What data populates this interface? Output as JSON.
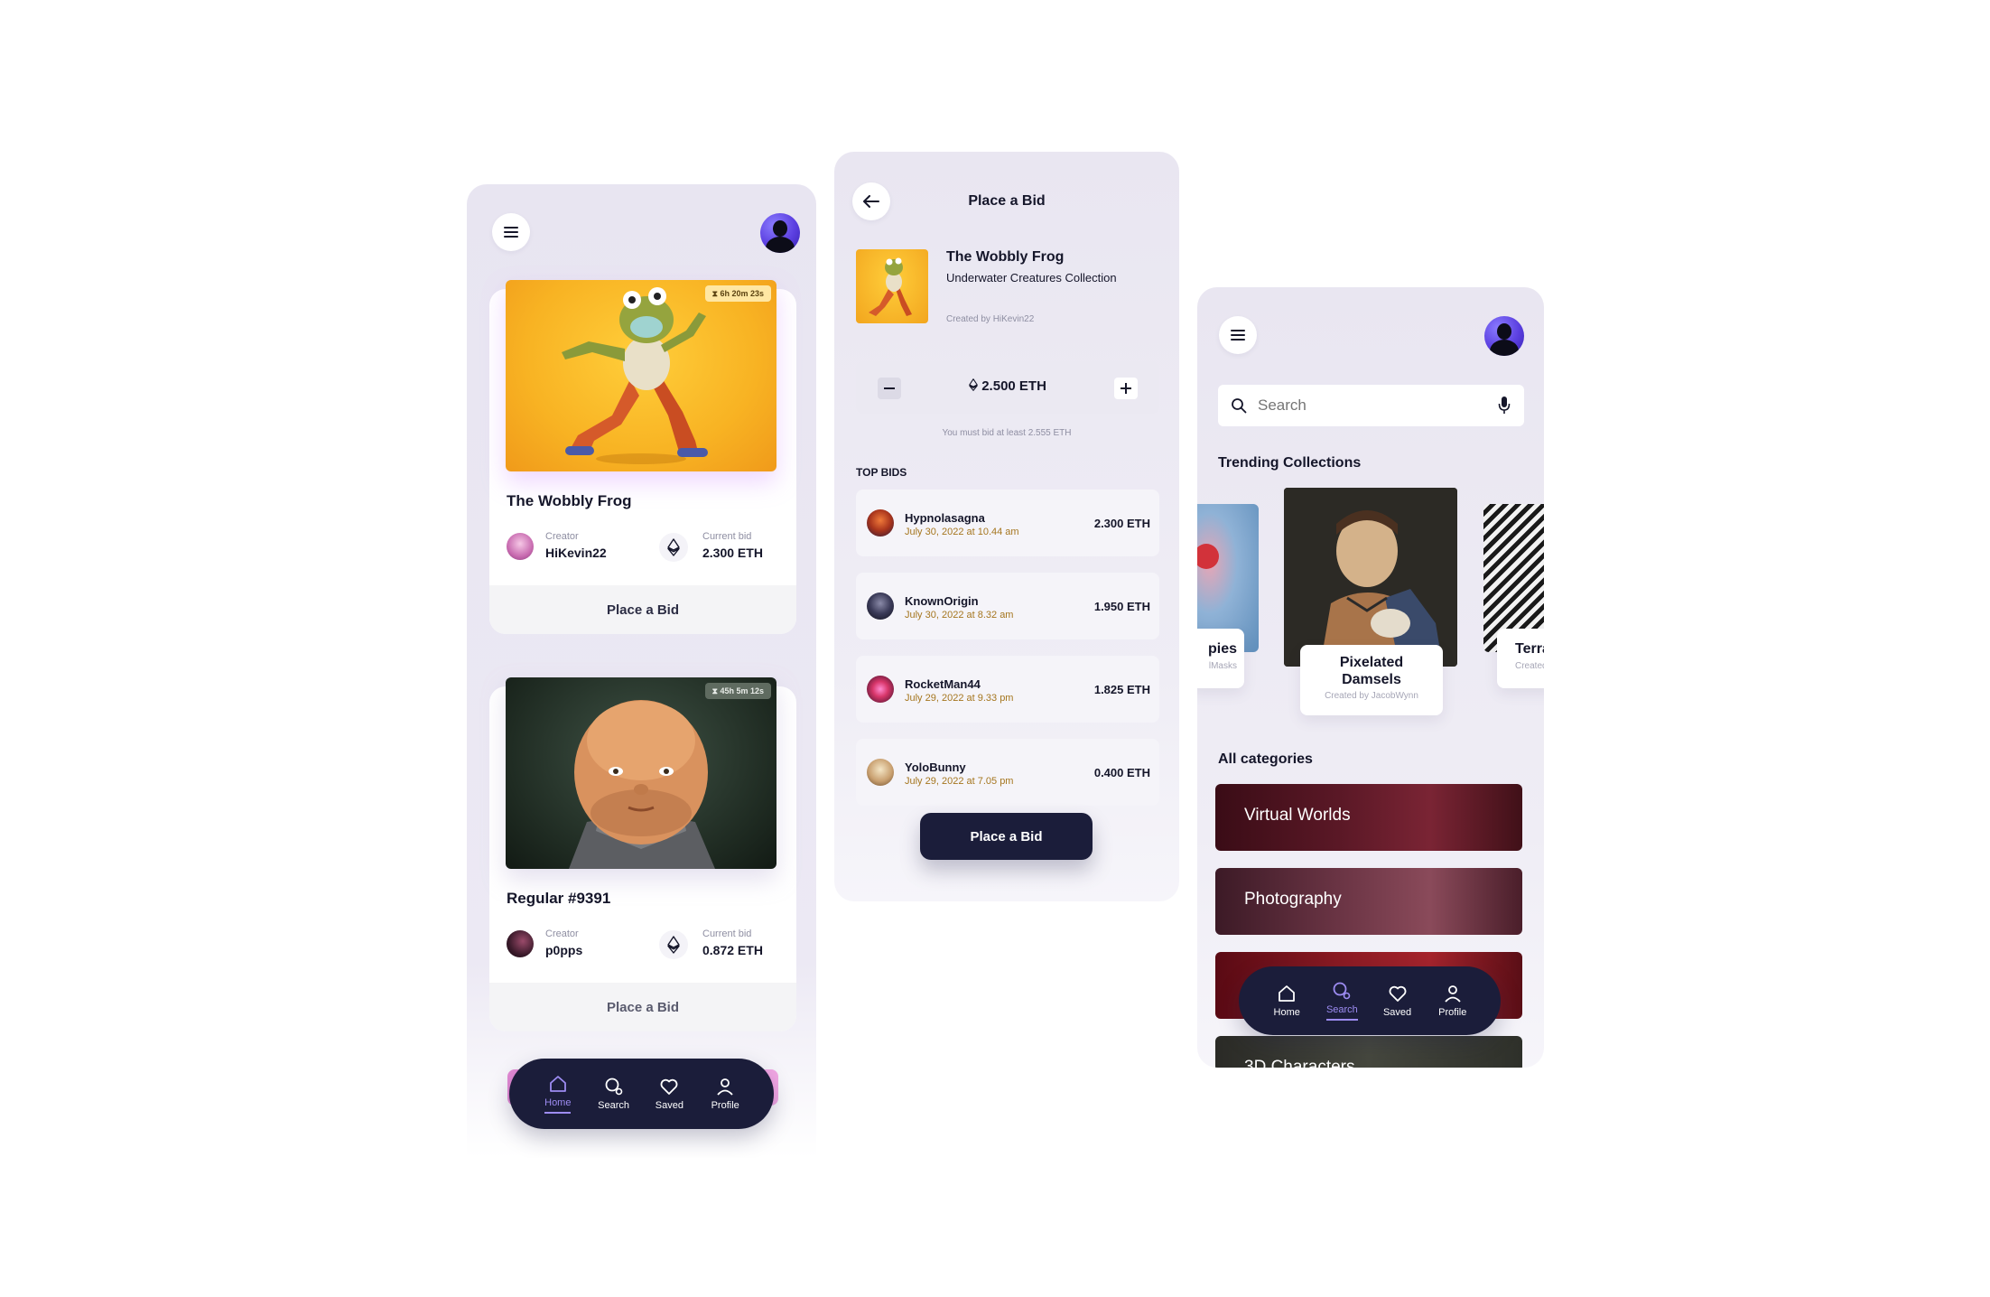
{
  "home": {
    "cards": [
      {
        "timer": "6h 20m 23s",
        "title": "The Wobbly Frog",
        "creator_label": "Creator",
        "creator": "HiKevin22",
        "bid_label": "Current bid",
        "bid": "2.300 ETH",
        "cta": "Place a Bid"
      },
      {
        "timer": "45h 5m 12s",
        "title": "Regular #9391",
        "creator_label": "Creator",
        "creator": "p0pps",
        "bid_label": "Current bid",
        "bid": "0.872 ETH",
        "cta": "Place a Bid"
      }
    ],
    "nav": {
      "home": "Home",
      "search": "Search",
      "saved": "Saved",
      "profile": "Profile",
      "active": "home"
    }
  },
  "bid_screen": {
    "title": "Place a Bid",
    "item_title": "The Wobbly Frog",
    "collection": "Underwater Creatures Collection",
    "created_by": "Created by HiKevin22",
    "amount": "2.500 ETH",
    "hint": "You must bid at least 2.555 ETH",
    "top_bids_label": "TOP BIDS",
    "bids": [
      {
        "name": "Hypnolasagna",
        "date": "July 30, 2022 at 10.44 am",
        "amount": "2.300 ETH"
      },
      {
        "name": "KnownOrigin",
        "date": "July 30, 2022 at 8.32 am",
        "amount": "1.950 ETH"
      },
      {
        "name": "RocketMan44",
        "date": "July 29, 2022 at 9.33 pm",
        "amount": "1.825 ETH"
      },
      {
        "name": "YoloBunny",
        "date": "July 29, 2022 at 7.05 pm",
        "amount": "0.400 ETH"
      }
    ],
    "cta": "Place a Bid"
  },
  "search_screen": {
    "search_placeholder": "Search",
    "trending_label": "Trending Collections",
    "collections": [
      {
        "title": "pies",
        "sub": "lMasks"
      },
      {
        "title": "Pixelated Damsels",
        "sub": "Created by JacobWynn"
      },
      {
        "title": "Terra",
        "sub": "Created"
      }
    ],
    "all_categories_label": "All categories",
    "categories": [
      "Virtual Worlds",
      "Photography",
      "",
      "3D Characters"
    ],
    "nav": {
      "home": "Home",
      "search": "Search",
      "saved": "Saved",
      "profile": "Profile",
      "active": "search"
    }
  },
  "colors": {
    "nav_bg": "#1b1d3a",
    "accent": "#9d8cf2",
    "panel_bg": "#ece9f4",
    "bid_date": "#a5761f"
  }
}
